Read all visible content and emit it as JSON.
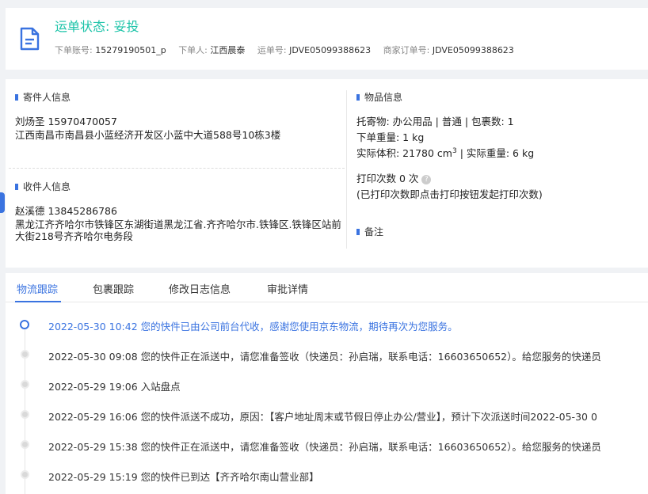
{
  "header": {
    "status_title": "运单状态: 妥投",
    "meta": [
      {
        "label": "下单账号:",
        "value": "15279190501_p"
      },
      {
        "label": "下单人:",
        "value": "江西晨泰"
      },
      {
        "label": "运单号:",
        "value": "JDVE05099388623"
      },
      {
        "label": "商家订单号:",
        "value": "JDVE05099388623"
      }
    ]
  },
  "sender": {
    "title": "寄件人信息",
    "name_phone": "刘炀圣   15970470057",
    "address": "江西南昌市南昌县小蓝经济开发区小蓝中大道588号10栋3楼"
  },
  "receiver": {
    "title": "收件人信息",
    "name_phone": "赵溪德   13845286786",
    "address": "黑龙江齐齐哈尔市铁锋区东湖街道黑龙江省.齐齐哈尔市.铁锋区.铁锋区站前大街218号齐齐哈尔电务段"
  },
  "goods": {
    "title": "物品信息",
    "line1": "托寄物:  办公用品 | 普通  |  包裹数:  1",
    "line2": "下单重量:   1 kg",
    "line3_prefix": "实际体积:   21780 cm",
    "line3_sup": "3",
    "line3_suffix": " | 实际重量:   6 kg",
    "print_count": "打印次数   0 次",
    "print_note": "(已打印次数即点击打印按钮发起打印次数)"
  },
  "remark": {
    "title": "备注"
  },
  "tabs": [
    {
      "label": "物流跟踪"
    },
    {
      "label": "包裹跟踪"
    },
    {
      "label": "修改日志信息"
    },
    {
      "label": "审批详情"
    }
  ],
  "timeline": [
    {
      "text": "2022-05-30 10:42 您的快件已由公司前台代收，感谢您使用京东物流，期待再次为您服务。"
    },
    {
      "text": "2022-05-30 09:08 您的快件正在派送中，请您准备签收（快递员：孙启瑞，联系电话：16603650652）。给您服务的快递员"
    },
    {
      "text": "2022-05-29 19:06 入站盘点"
    },
    {
      "text": "2022-05-29 16:06 您的快件派送不成功，原因：【客户地址周末或节假日停止办公/营业】，预计下次派送时间2022-05-30 0"
    },
    {
      "text": "2022-05-29 15:38 您的快件正在派送中，请您准备签收（快递员：孙启瑞，联系电话：16603650652）。给您服务的快递员"
    },
    {
      "text": "2022-05-29 15:19 您的快件已到达【齐齐哈尔南山营业部】"
    }
  ],
  "icons": {
    "doc": "document-icon",
    "help": "help-circle-icon"
  },
  "colors": {
    "accent": "#3a73e0",
    "status": "#1cc3a8"
  }
}
